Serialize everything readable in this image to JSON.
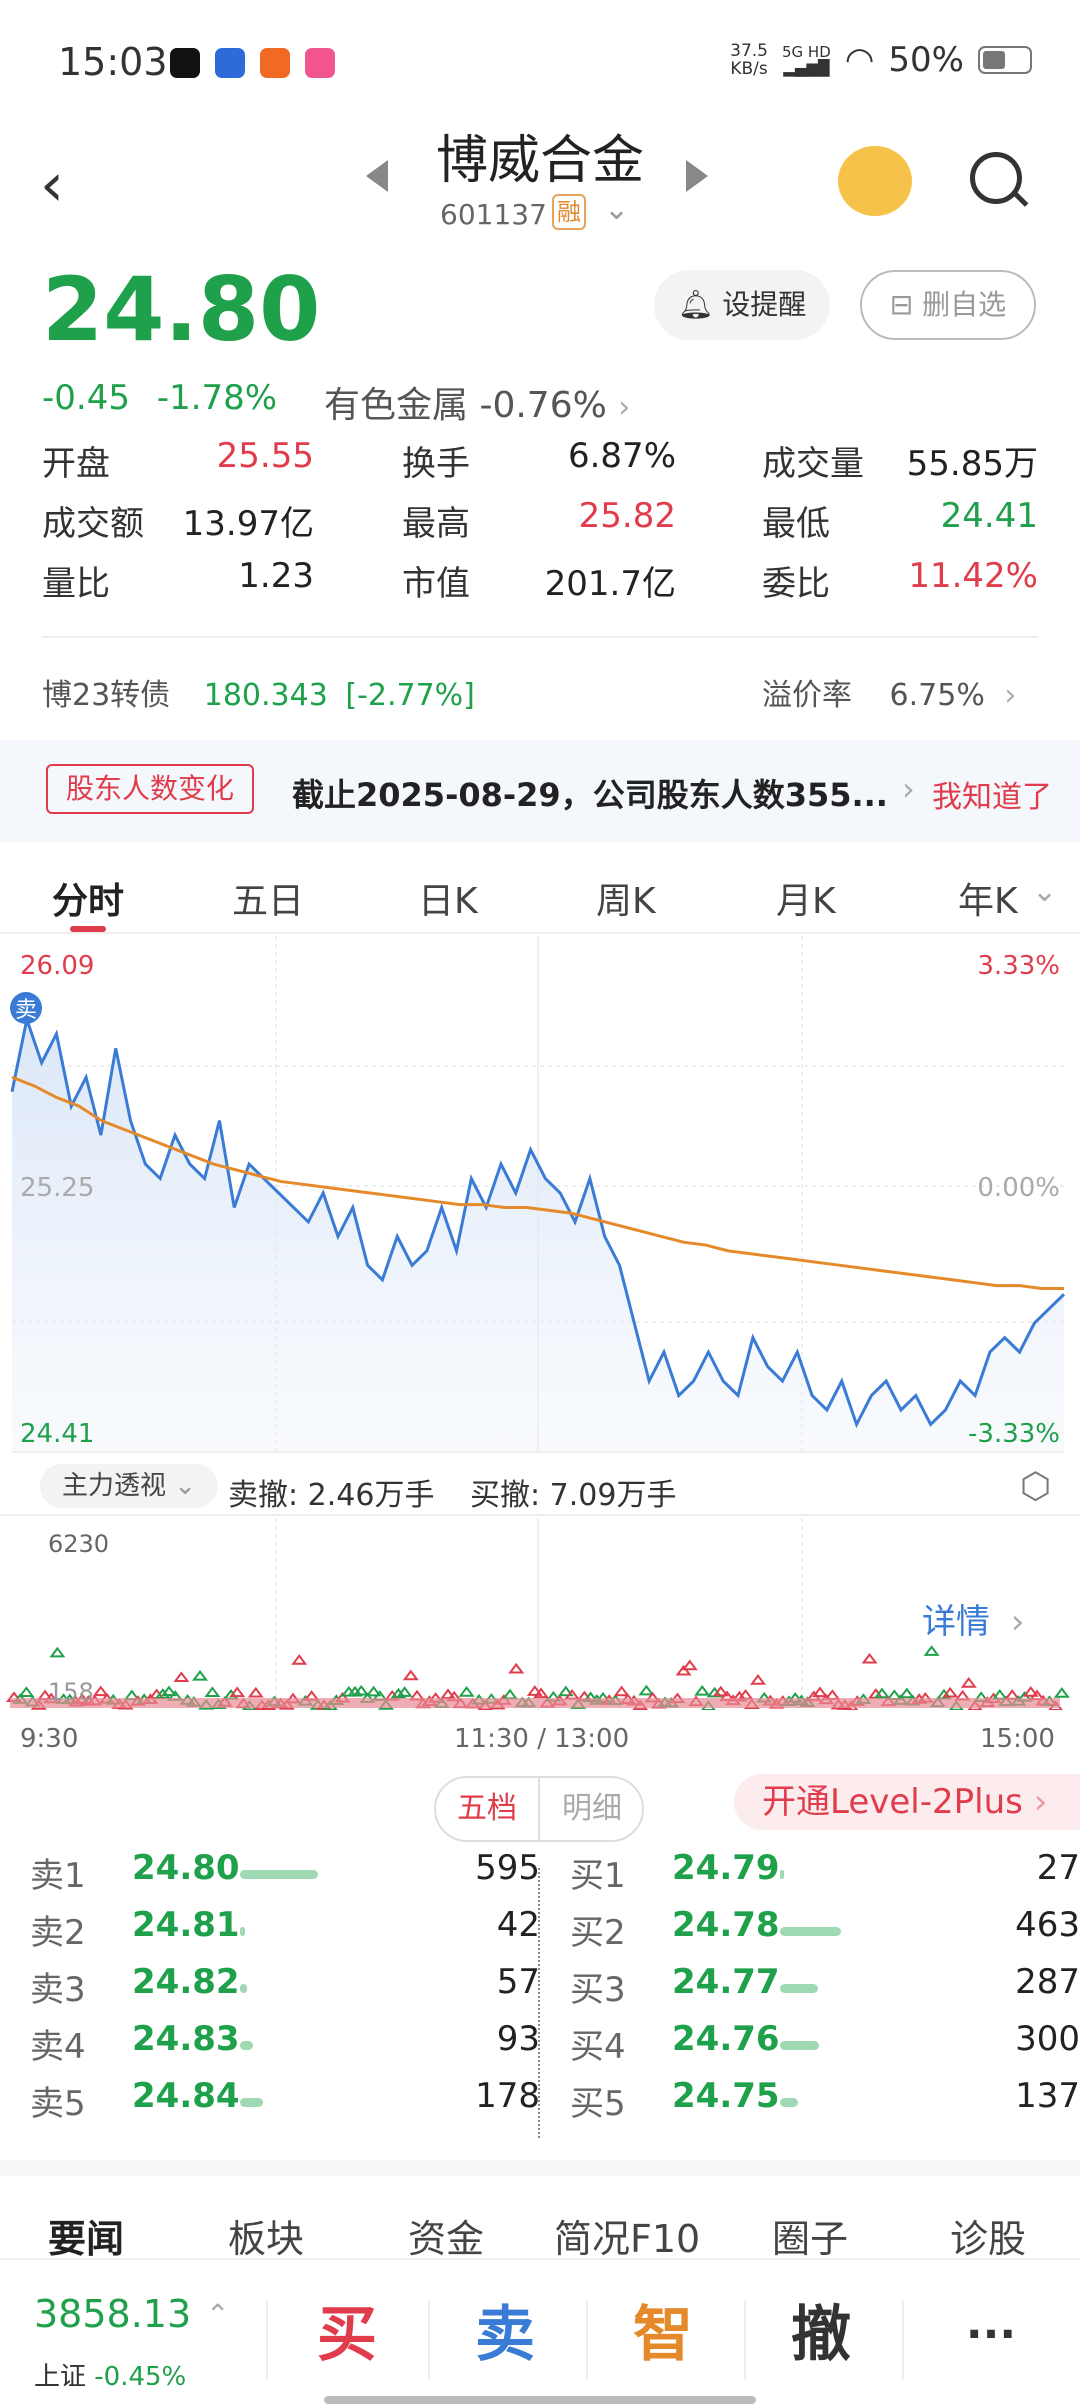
{
  "status": {
    "time": "15:03",
    "net_speed_value": "37.5",
    "net_speed_unit": "KB/s",
    "signal_label": "5G HD",
    "battery": "50%"
  },
  "header": {
    "stock_name": "博威合金",
    "stock_code": "601137",
    "margin_badge": "融"
  },
  "quote": {
    "price": "24.80",
    "change": "-0.45",
    "change_pct": "-1.78%",
    "sector": "有色金属",
    "sector_change": "-0.76%",
    "alert_label": "设提醒",
    "fav_label": "删自选"
  },
  "stats": [
    [
      {
        "label": "开盘",
        "value": "25.55",
        "color": "red"
      },
      {
        "label": "换手",
        "value": "6.87%",
        "color": "black"
      },
      {
        "label": "成交量",
        "value": "55.85万",
        "color": "black"
      }
    ],
    [
      {
        "label": "成交额",
        "value": "13.97亿",
        "color": "black"
      },
      {
        "label": "最高",
        "value": "25.82",
        "color": "red"
      },
      {
        "label": "最低",
        "value": "24.41",
        "color": "green"
      }
    ],
    [
      {
        "label": "量比",
        "value": "1.23",
        "color": "black"
      },
      {
        "label": "市值",
        "value": "201.7亿",
        "color": "black"
      },
      {
        "label": "委比",
        "value": "11.42%",
        "color": "red"
      }
    ]
  ],
  "bond": {
    "name": "博23转债",
    "value": "180.343",
    "change": "[-2.77%]",
    "premium_label": "溢价率",
    "premium_value": "6.75%"
  },
  "banner": {
    "tag": "股东人数变化",
    "text": "截止2025-08-29，公司股东人数355...",
    "ok": "我知道了"
  },
  "tabs": [
    "分时",
    "五日",
    "日K",
    "周K",
    "月K",
    "年K"
  ],
  "chart_data": {
    "type": "line",
    "price_high": "26.09",
    "price_mid": "25.25",
    "price_low": "24.41",
    "pct_high": "3.33%",
    "pct_mid": "0.00%",
    "pct_low": "-3.33%",
    "marker": "卖",
    "ylim": [
      24.41,
      26.09
    ],
    "series": [
      {
        "values": [
          25.6,
          25.85,
          25.7,
          25.8,
          25.55,
          25.65,
          25.45,
          25.75,
          25.5,
          25.35,
          25.3,
          25.45,
          25.35,
          25.3,
          25.5,
          25.2,
          25.35,
          25.3,
          25.25,
          25.2,
          25.15,
          25.25,
          25.1,
          25.2,
          25.0,
          24.95,
          25.1,
          25.0,
          25.05,
          25.2,
          25.05,
          25.3,
          25.2,
          25.35,
          25.25,
          25.4,
          25.3,
          25.25,
          25.15,
          25.3,
          25.1,
          25.0,
          24.8,
          24.6,
          24.7,
          24.55,
          24.6,
          24.7,
          24.6,
          24.55,
          24.75,
          24.65,
          24.6,
          24.7,
          24.55,
          24.5,
          24.6,
          24.45,
          24.55,
          24.6,
          24.5,
          24.55,
          24.45,
          24.5,
          24.6,
          24.55,
          24.7,
          24.75,
          24.7,
          24.8,
          24.85,
          24.9
        ]
      },
      {
        "values": [
          25.65,
          25.62,
          25.58,
          25.55,
          25.5,
          25.47,
          25.44,
          25.41,
          25.38,
          25.35,
          25.33,
          25.31,
          25.29,
          25.28,
          25.27,
          25.26,
          25.25,
          25.24,
          25.23,
          25.22,
          25.21,
          25.21,
          25.2,
          25.2,
          25.19,
          25.18,
          25.16,
          25.14,
          25.12,
          25.1,
          25.08,
          25.07,
          25.05,
          25.04,
          25.03,
          25.02,
          25.01,
          25.0,
          24.99,
          24.98,
          24.97,
          24.96,
          24.95,
          24.94,
          24.93,
          24.93,
          24.92,
          24.92
        ]
      }
    ]
  },
  "sub_bar": {
    "pill": "主力透视",
    "sell_cancel": "卖撤: 2.46万手",
    "buy_cancel": "买撤: 7.09万手"
  },
  "volume": {
    "top": "6230",
    "bottom": "158",
    "detail": "详情"
  },
  "time_axis": {
    "start": "9:30",
    "mid": "11:30 / 13:00",
    "end": "15:00"
  },
  "order_book": {
    "tab_active": "五档",
    "tab_inactive": "明细",
    "level2": "开通Level-2Plus",
    "sells": [
      {
        "label": "卖1",
        "price": "24.80",
        "qty": "595",
        "bar": 0.6
      },
      {
        "label": "卖2",
        "price": "24.81",
        "qty": "42",
        "bar": 0.04
      },
      {
        "label": "卖3",
        "price": "24.82",
        "qty": "57",
        "bar": 0.05
      },
      {
        "label": "卖4",
        "price": "24.83",
        "qty": "93",
        "bar": 0.1
      },
      {
        "label": "卖5",
        "price": "24.84",
        "qty": "178",
        "bar": 0.18
      }
    ],
    "buys": [
      {
        "label": "买1",
        "price": "24.79",
        "qty": "27",
        "bar": 0.03
      },
      {
        "label": "买2",
        "price": "24.78",
        "qty": "463",
        "bar": 0.47
      },
      {
        "label": "买3",
        "price": "24.77",
        "qty": "287",
        "bar": 0.29
      },
      {
        "label": "买4",
        "price": "24.76",
        "qty": "300",
        "bar": 0.3
      },
      {
        "label": "买5",
        "price": "24.75",
        "qty": "137",
        "bar": 0.14
      }
    ]
  },
  "news_tabs": [
    "要闻",
    "板块",
    "资金",
    "简况F10",
    "圈子",
    "诊股"
  ],
  "bottom": {
    "index_value": "3858.13",
    "index_name": "上证",
    "index_change": "-0.45%",
    "buy": "买",
    "sell": "卖",
    "smart": "智",
    "cancel": "撤",
    "more": "···"
  }
}
